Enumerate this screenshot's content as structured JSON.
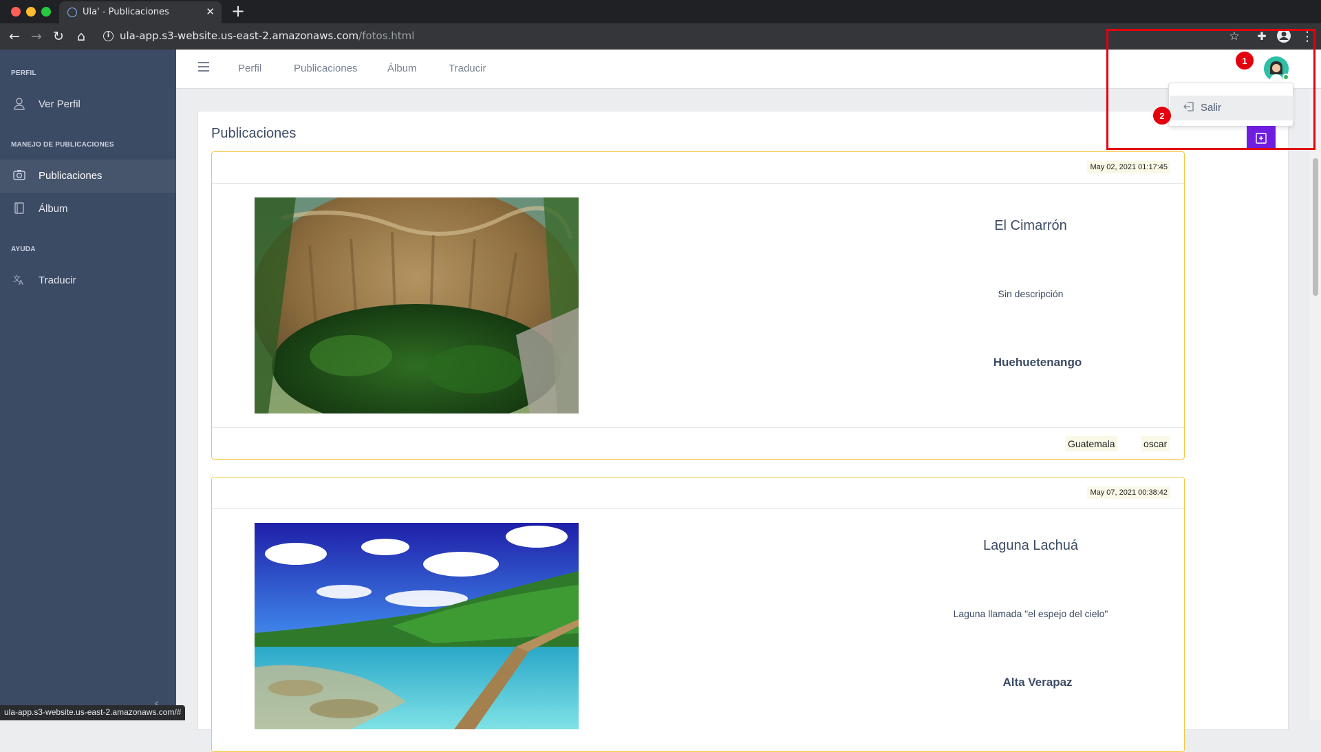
{
  "browser": {
    "tab_title": "Ula' - Publicaciones",
    "url_host": "ula-app.s3-website.us-east-2.amazonaws.com",
    "url_path": "/fotos.html",
    "status_url": "ula-app.s3-website.us-east-2.amazonaws.com/#"
  },
  "sidebar": {
    "sections": [
      {
        "title": "PERFIL",
        "items": [
          {
            "label": "Ver Perfil",
            "icon": "user-icon"
          }
        ]
      },
      {
        "title": "MANEJO DE PUBLICACIONES",
        "items": [
          {
            "label": "Publicaciones",
            "icon": "camera-icon",
            "active": true
          },
          {
            "label": "Álbum",
            "icon": "book-icon"
          }
        ]
      },
      {
        "title": "AYUDA",
        "items": [
          {
            "label": "Traducir",
            "icon": "translate-icon"
          }
        ]
      }
    ]
  },
  "header": {
    "nav": [
      "Perfil",
      "Publicaciones",
      "Álbum",
      "Traducir"
    ]
  },
  "user_menu": {
    "logout_label": "Salir"
  },
  "annotations": {
    "marker_1": "1",
    "marker_2": "2"
  },
  "main": {
    "title": "Publicaciones",
    "posts": [
      {
        "date": "May 02, 2021 01:17:45",
        "title": "El Cimarrón",
        "description": "Sin descripción",
        "location": "Huehuetenango",
        "tags": [
          "Guatemala",
          "oscar"
        ],
        "image": "sinkhole-photo"
      },
      {
        "date": "May 07, 2021 00:38:42",
        "title": "Laguna Lachuá",
        "description": "Laguna llamada \"el espejo del cielo\"",
        "location": "Alta Verapaz",
        "image": "lagoon-photo"
      }
    ]
  },
  "colors": {
    "sidebar": "#3c4b64",
    "post_border": "#f5c842",
    "accent": "#6f1ee0",
    "annotation": "#e3000f"
  }
}
